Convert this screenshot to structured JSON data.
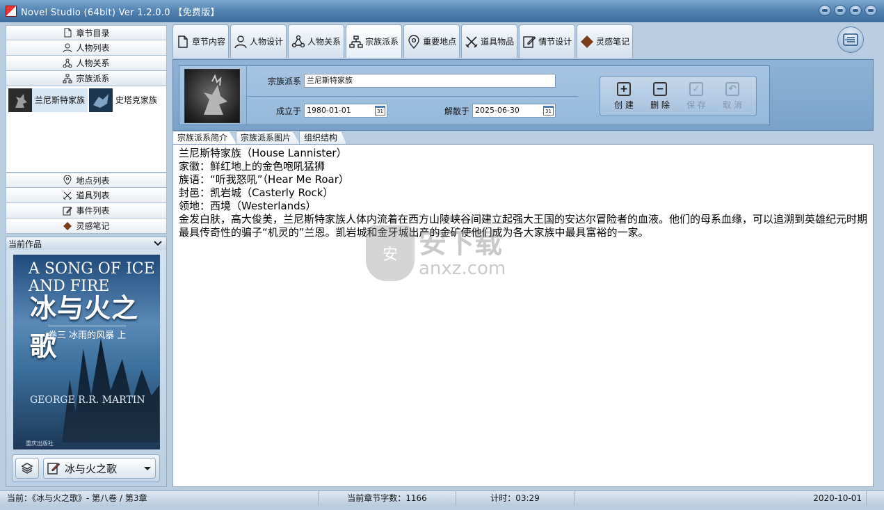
{
  "window": {
    "title": "Novel Studio  (64bit)  Ver 1.2.0.0 【免费版】"
  },
  "sidebar": {
    "nav_top": [
      {
        "label": "章节目录",
        "icon": "document-icon"
      },
      {
        "label": "人物列表",
        "icon": "person-icon"
      },
      {
        "label": "人物关系",
        "icon": "relation-icon"
      },
      {
        "label": "宗族派系",
        "icon": "hierarchy-icon"
      }
    ],
    "clans": [
      {
        "name": "兰尼斯特家族"
      },
      {
        "name": "史塔克家族"
      }
    ],
    "nav_bottom": [
      {
        "label": "地点列表",
        "icon": "location-icon"
      },
      {
        "label": "道具列表",
        "icon": "swords-icon"
      },
      {
        "label": "事件列表",
        "icon": "edit-icon"
      },
      {
        "label": "灵感笔记",
        "icon": "diamond-icon"
      }
    ],
    "current_work_label": "当前作品",
    "cover": {
      "title_en": "A SONG OF ICE AND FIRE",
      "title_cn": "冰与火之歌",
      "volume": "卷三 冰雨的风暴 上",
      "author": "GEORGE R.R. MARTIN",
      "publisher": "重庆出版社"
    },
    "work_select_value": "冰与火之歌"
  },
  "tabs": [
    {
      "label": "章节内容",
      "icon": "document-icon"
    },
    {
      "label": "人物设计",
      "icon": "person-icon"
    },
    {
      "label": "人物关系",
      "icon": "relation-icon"
    },
    {
      "label": "宗族派系",
      "icon": "hierarchy-icon"
    },
    {
      "label": "重要地点",
      "icon": "location-icon"
    },
    {
      "label": "道具物品",
      "icon": "swords-icon"
    },
    {
      "label": "情节设计",
      "icon": "edit-icon"
    },
    {
      "label": "灵感笔记",
      "icon": "diamond-icon"
    }
  ],
  "form": {
    "clan_label": "宗族派系",
    "clan_value": "兰尼斯特家族",
    "founded_label": "成立于",
    "founded_value": "1980-01-01",
    "dissolved_label": "解散于",
    "dissolved_value": "2025-06-30",
    "calendar_day": "31"
  },
  "actions": [
    {
      "label": "创 建",
      "icon": "plus-icon",
      "glyph": "+"
    },
    {
      "label": "删 除",
      "icon": "minus-icon",
      "glyph": "−"
    },
    {
      "label": "保 存",
      "icon": "check-icon",
      "glyph": "✓"
    },
    {
      "label": "取 消",
      "icon": "undo-icon",
      "glyph": "↶"
    }
  ],
  "subtabs": [
    "宗族派系简介",
    "宗族派系图片",
    "组织结构"
  ],
  "content_lines": [
    "兰尼斯特家族（House Lannister）",
    "家徽：鲜红地上的金色咆吼猛狮",
    "族语：“听我怒吼”（Hear Me Roar）",
    "封邑：凯岩城（Casterly Rock）",
    "领地：西境（Westerlands）",
    "金发白肤，高大俊美，兰尼斯特家族人体内流着在西方山陵峡谷间建立起强大王国的安达尔冒险者的血液。他们的母系血缘，可以追溯到英雄纪元时期最具传奇性的骗子“机灵的”兰恩。凯岩城和金牙城出产的金矿使他们成为各大家族中最具富裕的一家。"
  ],
  "watermark": {
    "shield": "安",
    "big": "安下载",
    "small": "anxz.com"
  },
  "status": {
    "current": "当前：《冰与火之歌》- 第八卷 / 第3章",
    "word_count": "当前章节字数：1166",
    "timer": "计时：03:29",
    "date": "2020-10-01"
  },
  "colors": {
    "titlebar": "#4f7fae",
    "panel": "#8fb3d6",
    "selected": "#d6e6f5"
  }
}
